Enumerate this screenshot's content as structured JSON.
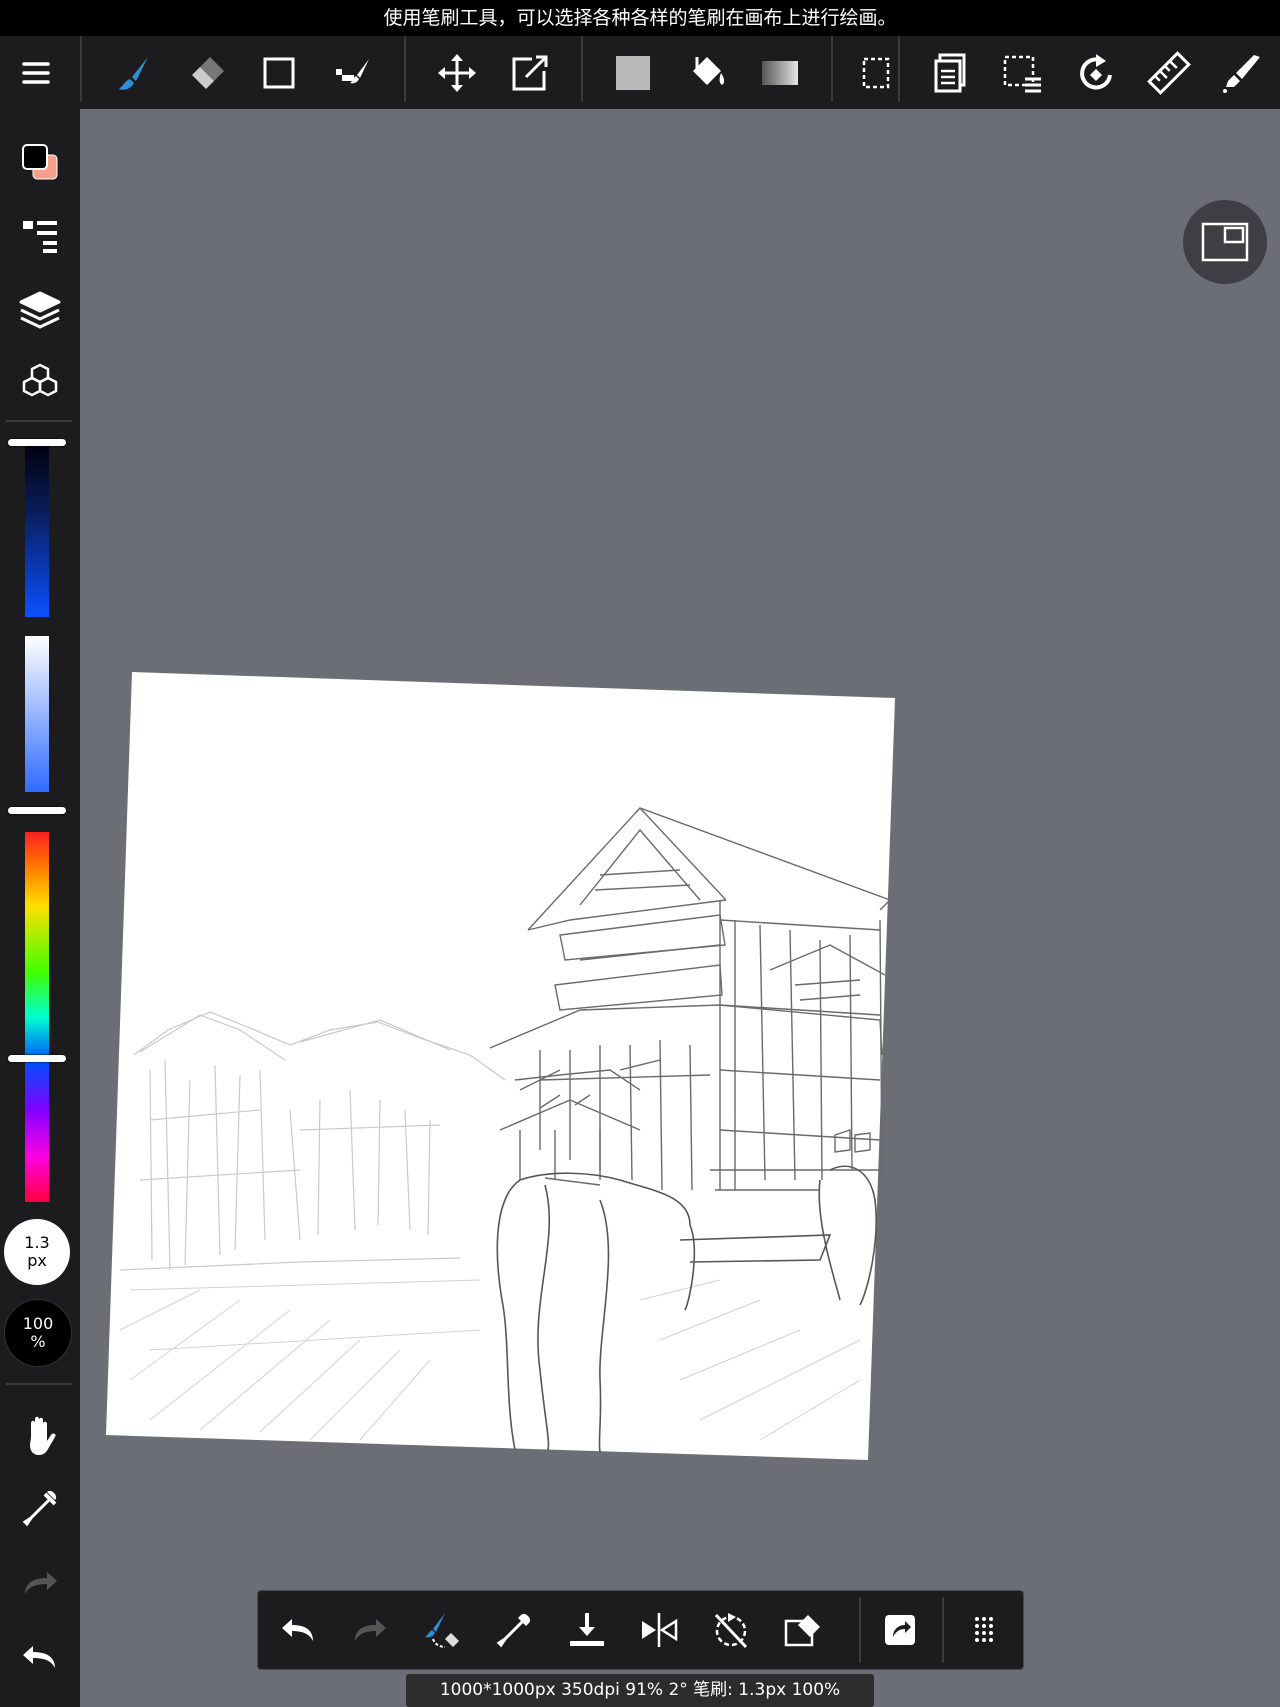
{
  "tooltip": "使用笔刷工具，可以选择各种各样的笔刷在画布上进行绘画。",
  "toolbar": {
    "icons": [
      "menu-icon",
      "brush-icon",
      "eraser-icon",
      "rectangle-icon",
      "dot-icon",
      "move-icon",
      "transform-icon",
      "fill-color-icon",
      "bucket-icon",
      "gradient-icon",
      "selection-icon",
      "layers-copy-icon",
      "select-list-icon",
      "rotate-icon",
      "ruler-icon",
      "pen-tool-icon"
    ],
    "active": "brush-icon"
  },
  "sidebar": {
    "primary_color": "#000000",
    "secondary_color": "#f4a08c",
    "brush_size": {
      "value": "1.3",
      "unit": "px"
    },
    "opacity": {
      "value": "100",
      "unit": "%"
    }
  },
  "status_bar": "1000*1000px 350dpi 91% 2° 笔刷: 1.3px 100%",
  "colors": {
    "accent": "#2f8fd6",
    "background": "#6b6e74",
    "panel": "#1c1c1e"
  }
}
